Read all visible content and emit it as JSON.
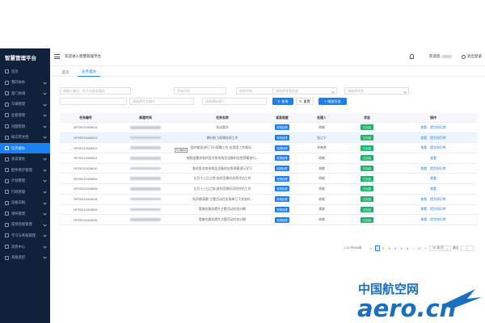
{
  "sidebar": {
    "title": "智慧管理平台",
    "items": [
      {
        "label": "首页",
        "chevron": false
      },
      {
        "label": "我的协办",
        "chevron": true
      },
      {
        "label": "部门协调",
        "chevron": true
      },
      {
        "label": "车辆管理",
        "chevron": true
      },
      {
        "label": "业管管理",
        "chevron": true
      },
      {
        "label": "问题管理",
        "chevron": true
      },
      {
        "label": "知识库文档",
        "chevron": true
      },
      {
        "label": "任务督办",
        "chevron": false
      },
      {
        "label": "会议督办",
        "chevron": true
      },
      {
        "label": "配件库存管理",
        "chevron": true
      },
      {
        "label": "计划管理",
        "chevron": true
      },
      {
        "label": "行政管理",
        "chevron": true
      },
      {
        "label": "设备日报",
        "chevron": true
      },
      {
        "label": "领导管理",
        "chevron": true
      },
      {
        "label": "现场巡视管理",
        "chevron": true
      },
      {
        "label": "学习与考核管理",
        "chevron": true
      },
      {
        "label": "消息中心",
        "chevron": true
      },
      {
        "label": "系统监控",
        "chevron": true
      }
    ]
  },
  "header": {
    "welcome": "欢迎进入智慧管理平台",
    "user_prefix": "欢迎您,",
    "logout": "退出登录"
  },
  "tabs": [
    {
      "label": "首页"
    },
    {
      "label": "任务督办"
    }
  ],
  "filters": {
    "placeholders": {
      "keyword": "请输入编号、任务名称或督办",
      "start_time": "开始时间",
      "end_time": "结束时间",
      "urgency": "请选择紧急程度",
      "status": "请选择状态",
      "task_code": "请选择任务编号",
      "handler": "请选择处理人"
    },
    "search_label": "查询",
    "reset_label": "重置",
    "add_label": "增加任务"
  },
  "table": {
    "columns": [
      "任务编号",
      "新建时间",
      "任务名称",
      "紧急程度",
      "处理人",
      "状态",
      "操作"
    ],
    "rows": [
      {
        "code": "RP20210428014",
        "name": "伴送督办",
        "urgency": "常规处理",
        "handler": "胡威",
        "status": "已办结",
        "ops": [
          "查看",
          "提交知识库"
        ]
      },
      {
        "code": "RP20210428013",
        "name": "做好航飞保障协调工作",
        "urgency": "常规处理",
        "handler": "张江宁",
        "status": "已办结",
        "ops": [
          "查看",
          "提交知识库"
        ]
      },
      {
        "code": "RP20210428012",
        "name": "国内航班进行飞行保障工作,应用国工作督导...",
        "urgency": "常规处理",
        "handler": "李晓勇",
        "status": "已办结",
        "ops": [
          "查看",
          "提交知识库"
        ]
      },
      {
        "code": "RP20210428011",
        "name": "按照部署求各科室对各系统及设备的应急预案进行...",
        "urgency": "常规处理",
        "handler": "胡威",
        "status": "已办结",
        "ops": [
          "查看"
        ]
      },
      {
        "code": "RP20210428010",
        "name": "各科室对各系统及设备的应急预案进行学习",
        "urgency": "常规处理",
        "handler": "胡威",
        "status": "已办结",
        "ops": [
          "查看",
          "提交知识库"
        ]
      },
      {
        "code": "RP20210428009",
        "name": "五月十三日之前,各科室做好风险评估工作",
        "urgency": "常规处理",
        "handler": "胡威",
        "status": "已办结",
        "ops": [
          "查看"
        ]
      },
      {
        "code": "RP20210428008",
        "name": "五月十三日之前,各科室做好风险评估工作",
        "urgency": "常规处理",
        "handler": "胡威",
        "status": "已办结",
        "ops": [
          "查看"
        ]
      },
      {
        "code": "RP20210416014",
        "name": "\"机声朗清晨\"主题活动任务清单已下发各科...",
        "urgency": "常规处理",
        "handler": "胡威",
        "status": "已办结",
        "ops": [
          "查看",
          "提交知识库"
        ]
      },
      {
        "code": "RP20210416009",
        "name": "管复化服务提升主题活动任务分解",
        "urgency": "常规处理",
        "handler": "满意",
        "status": "已办结",
        "ops": [
          "查看",
          "提交知识库"
        ]
      },
      {
        "code": "RP20210416008",
        "name": "管复化服务提升主题活动任务分解",
        "urgency": "常规处理",
        "handler": "胡威",
        "status": "已办结",
        "ops": [
          "查看",
          "提交知识库"
        ]
      }
    ],
    "tooltip": "S-5624"
  },
  "pagination": {
    "total": "1-10 共164条",
    "prev": "<",
    "pages": [
      "1",
      "2",
      "3",
      "4",
      "5",
      "6",
      "...",
      "17"
    ],
    "next": ">",
    "page_size": "10 条/页",
    "goto_label": "跳至",
    "goto_value": "1"
  },
  "watermark": {
    "cn": "中国航空网",
    "en": "aero.cn"
  },
  "colors": {
    "sidebar_bg": "#10213c",
    "accent": "#1f7ef0",
    "success": "#1fb26b"
  }
}
